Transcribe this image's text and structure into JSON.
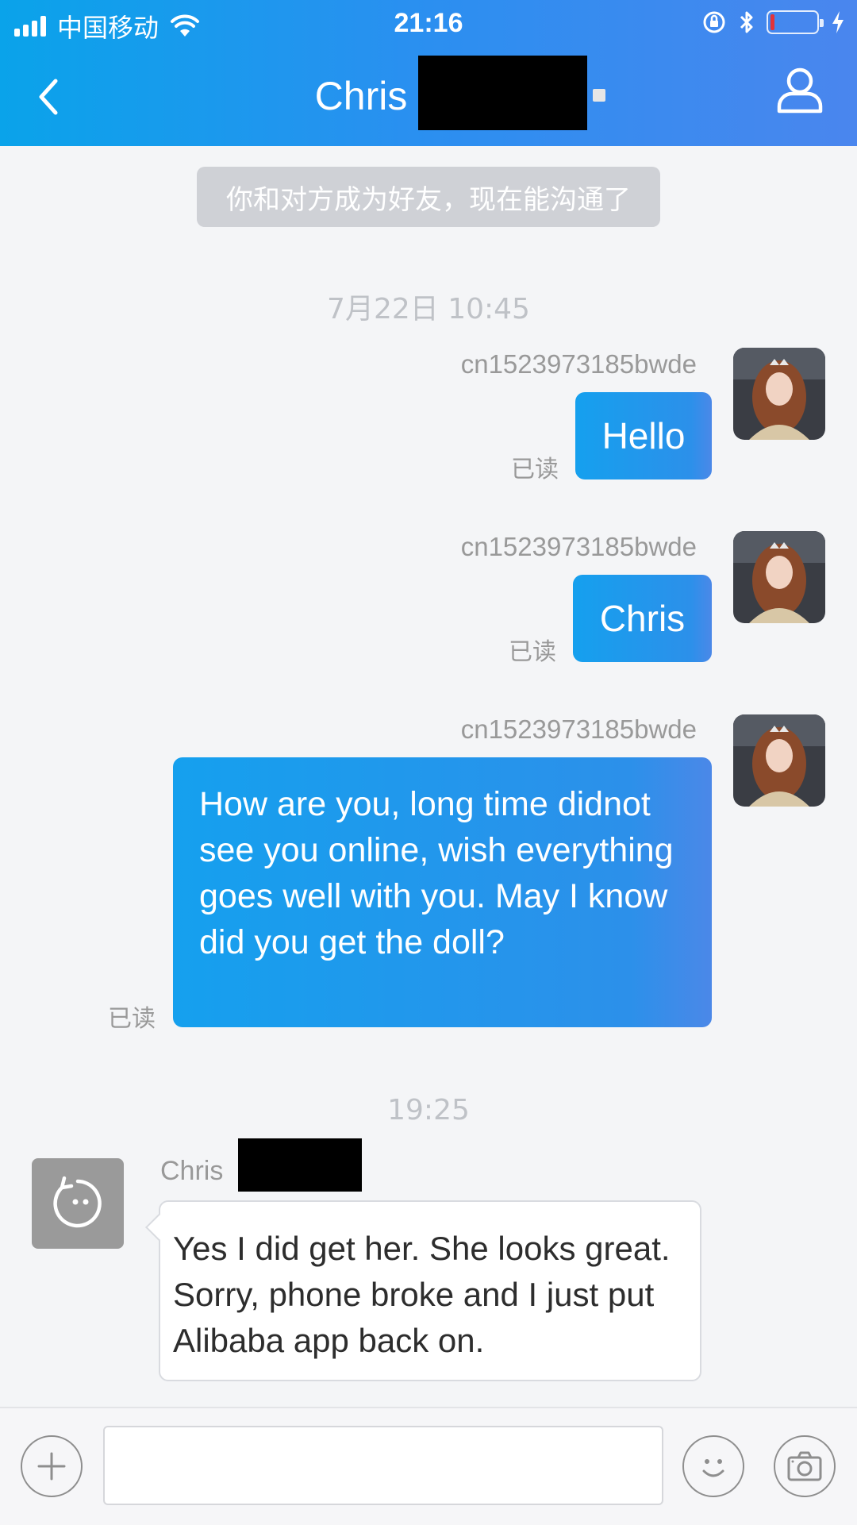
{
  "status_bar": {
    "carrier": "中国移动",
    "time": "21:16",
    "battery_level": 0.05
  },
  "header": {
    "title": "Chris",
    "back_icon": "chevron-left-icon",
    "profile_icon": "user-icon"
  },
  "chat": {
    "system_note": "你和对方成为好友，现在能沟通了",
    "timestamp_1": "7月22日 10:45",
    "timestamp_2": "19:25",
    "outgoing": [
      {
        "sender": "cn1523973185bwde",
        "text": "Hello",
        "status": "已读"
      },
      {
        "sender": "cn1523973185bwde",
        "text": "Chris",
        "status": "已读"
      },
      {
        "sender": "cn1523973185bwde",
        "text": "How are you, long time didnot see you online, wish everything goes well with you. May I know did you get the doll?",
        "status": "已读"
      }
    ],
    "incoming": {
      "sender": "Chris",
      "text": "Yes I did get her. She looks great. Sorry, phone broke and I just put Alibaba app back on."
    }
  },
  "input_bar": {
    "plus_icon": "plus-icon",
    "emoji_icon": "smiley-icon",
    "camera_icon": "camera-icon",
    "input_value": ""
  },
  "colors": {
    "header_start": "#0aa3ea",
    "header_end": "#4a86ee",
    "outgoing_bubble": "#1f9bec",
    "background": "#f4f5f7"
  }
}
